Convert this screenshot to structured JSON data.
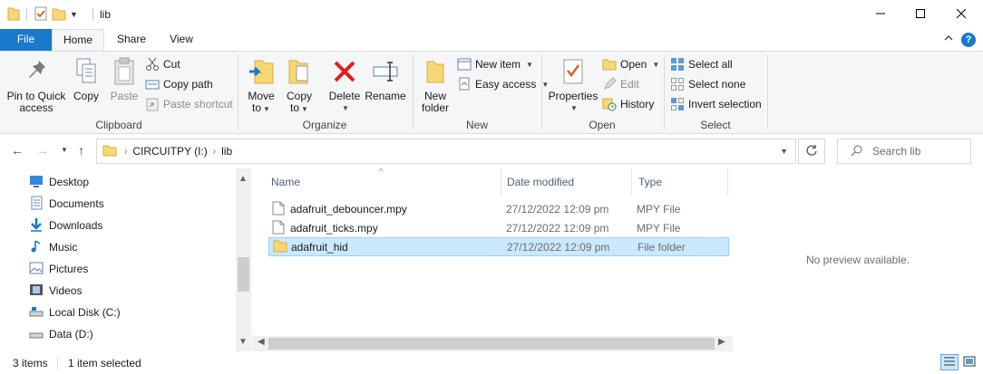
{
  "window": {
    "title": "lib",
    "controls": {
      "minimize": "minimize-icon",
      "maximize": "maximize-icon",
      "close": "close-icon"
    }
  },
  "ribbon_tabs": [
    "File",
    "Home",
    "Share",
    "View"
  ],
  "ribbon": {
    "clipboard": {
      "label": "Clipboard",
      "pin": "Pin to Quick access",
      "pin_line1": "Pin to Quick",
      "pin_line2": "access",
      "copy": "Copy",
      "paste": "Paste",
      "cut": "Cut",
      "copy_path": "Copy path",
      "paste_shortcut": "Paste shortcut"
    },
    "organize": {
      "label": "Organize",
      "move_to_1": "Move",
      "move_to_2": "to",
      "copy_to_1": "Copy",
      "copy_to_2": "to",
      "delete": "Delete",
      "rename": "Rename"
    },
    "new": {
      "label": "New",
      "new_folder_1": "New",
      "new_folder_2": "folder",
      "new_item": "New item",
      "easy_access": "Easy access"
    },
    "open": {
      "label": "Open",
      "properties": "Properties",
      "open": "Open",
      "edit": "Edit",
      "history": "History"
    },
    "select": {
      "label": "Select",
      "select_all": "Select all",
      "select_none": "Select none",
      "invert_selection": "Invert selection"
    }
  },
  "address": {
    "crumbs": [
      "CIRCUITPY (I:)",
      "lib"
    ],
    "search_placeholder": "Search lib"
  },
  "nav_pane": {
    "items": [
      {
        "label": "Desktop",
        "icon": "desktop-icon"
      },
      {
        "label": "Documents",
        "icon": "documents-icon"
      },
      {
        "label": "Downloads",
        "icon": "downloads-icon"
      },
      {
        "label": "Music",
        "icon": "music-icon"
      },
      {
        "label": "Pictures",
        "icon": "pictures-icon"
      },
      {
        "label": "Videos",
        "icon": "videos-icon"
      },
      {
        "label": "Local Disk (C:)",
        "icon": "drive-icon"
      },
      {
        "label": "Data (D:)",
        "icon": "drive-icon"
      }
    ]
  },
  "file_list": {
    "columns": [
      "Name",
      "Date modified",
      "Type"
    ],
    "rows": [
      {
        "name": "adafruit_debouncer.mpy",
        "date": "27/12/2022 12:09 pm",
        "type": "MPY File",
        "icon": "file-icon"
      },
      {
        "name": "adafruit_ticks.mpy",
        "date": "27/12/2022 12:09 pm",
        "type": "MPY File",
        "icon": "file-icon"
      },
      {
        "name": "adafruit_hid",
        "date": "27/12/2022 12:09 pm",
        "type": "File folder",
        "icon": "folder-icon",
        "selected": true
      }
    ]
  },
  "preview": {
    "text": "No preview available."
  },
  "status": {
    "items": "3 items",
    "selected": "1 item selected"
  },
  "colors": {
    "accent": "#1979ca",
    "selection": "#cce8ff",
    "folder": "#f8d775"
  }
}
